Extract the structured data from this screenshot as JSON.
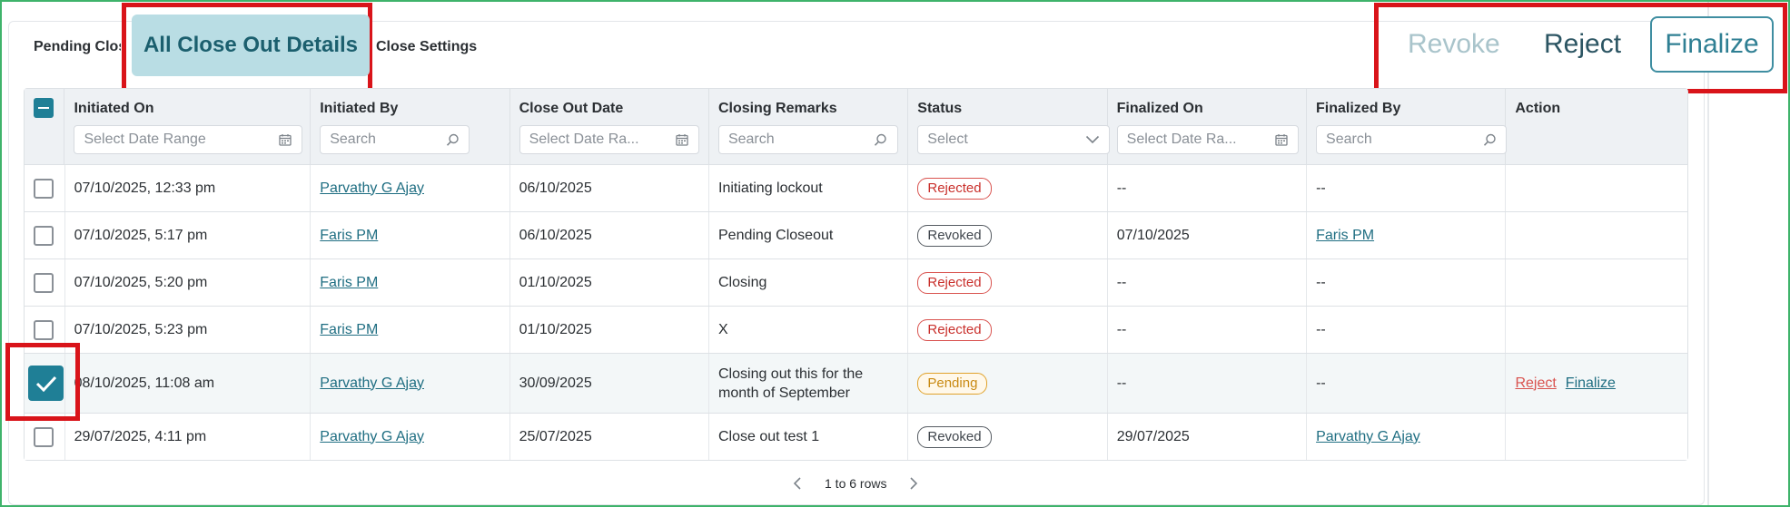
{
  "tabs": {
    "pending": "Pending Close Out",
    "active": "All Close Out Details",
    "settings": "Close Settings"
  },
  "actions": {
    "revoke": "Revoke",
    "reject": "Reject",
    "finalize": "Finalize"
  },
  "table": {
    "columns": [
      {
        "label": "Initiated On",
        "filter": "Select Date Range",
        "filter_icon": "calendar-icon"
      },
      {
        "label": "Initiated By",
        "filter": "Search",
        "filter_icon": "search-icon"
      },
      {
        "label": "Close Out Date",
        "filter": "Select Date Ra...",
        "filter_icon": "calendar-icon"
      },
      {
        "label": "Closing Remarks",
        "filter": "Search",
        "filter_icon": "search-icon"
      },
      {
        "label": "Status",
        "filter": "Select",
        "filter_icon": "chevron-down-icon"
      },
      {
        "label": "Finalized On",
        "filter": "Select Date Ra...",
        "filter_icon": "calendar-icon"
      },
      {
        "label": "Finalized By",
        "filter": "Search",
        "filter_icon": "search-icon"
      },
      {
        "label": "Action",
        "filter": "",
        "filter_icon": ""
      }
    ],
    "rows": [
      {
        "initiated_on": "07/10/2025, 12:33 pm",
        "initiated_by": "Parvathy G Ajay",
        "close_out_date": "06/10/2025",
        "remarks": "Initiating lockout",
        "status": "Rejected",
        "finalized_on": "--",
        "finalized_by": "--",
        "finalized_by_link": false,
        "selected": false
      },
      {
        "initiated_on": "07/10/2025, 5:17 pm",
        "initiated_by": "Faris PM",
        "close_out_date": "06/10/2025",
        "remarks": "Pending Closeout",
        "status": "Revoked",
        "finalized_on": "07/10/2025",
        "finalized_by": "Faris PM",
        "finalized_by_link": true,
        "selected": false
      },
      {
        "initiated_on": "07/10/2025, 5:20 pm",
        "initiated_by": "Faris PM",
        "close_out_date": "01/10/2025",
        "remarks": "Closing",
        "status": "Rejected",
        "finalized_on": "--",
        "finalized_by": "--",
        "finalized_by_link": false,
        "selected": false
      },
      {
        "initiated_on": "07/10/2025, 5:23 pm",
        "initiated_by": "Faris PM",
        "close_out_date": "01/10/2025",
        "remarks": "X",
        "status": "Rejected",
        "finalized_on": "--",
        "finalized_by": "--",
        "finalized_by_link": false,
        "selected": false
      },
      {
        "initiated_on": "08/10/2025, 11:08 am",
        "initiated_by": "Parvathy G Ajay",
        "close_out_date": "30/09/2025",
        "remarks": "Closing out this for the month of September",
        "status": "Pending",
        "finalized_on": "--",
        "finalized_by": "--",
        "finalized_by_link": false,
        "selected": true,
        "row_actions": [
          "Reject",
          "Finalize"
        ]
      },
      {
        "initiated_on": "29/07/2025, 4:11 pm",
        "initiated_by": "Parvathy G Ajay",
        "close_out_date": "25/07/2025",
        "remarks": "Close out test 1",
        "status": "Revoked",
        "finalized_on": "29/07/2025",
        "finalized_by": "Parvathy G Ajay",
        "finalized_by_link": true,
        "selected": false
      }
    ]
  },
  "pagination": {
    "text": "1 to 6 rows"
  },
  "colors": {
    "accent": "#1f7f96",
    "highlight": "#d9141a",
    "active_tab_bg": "#b9dde4"
  }
}
